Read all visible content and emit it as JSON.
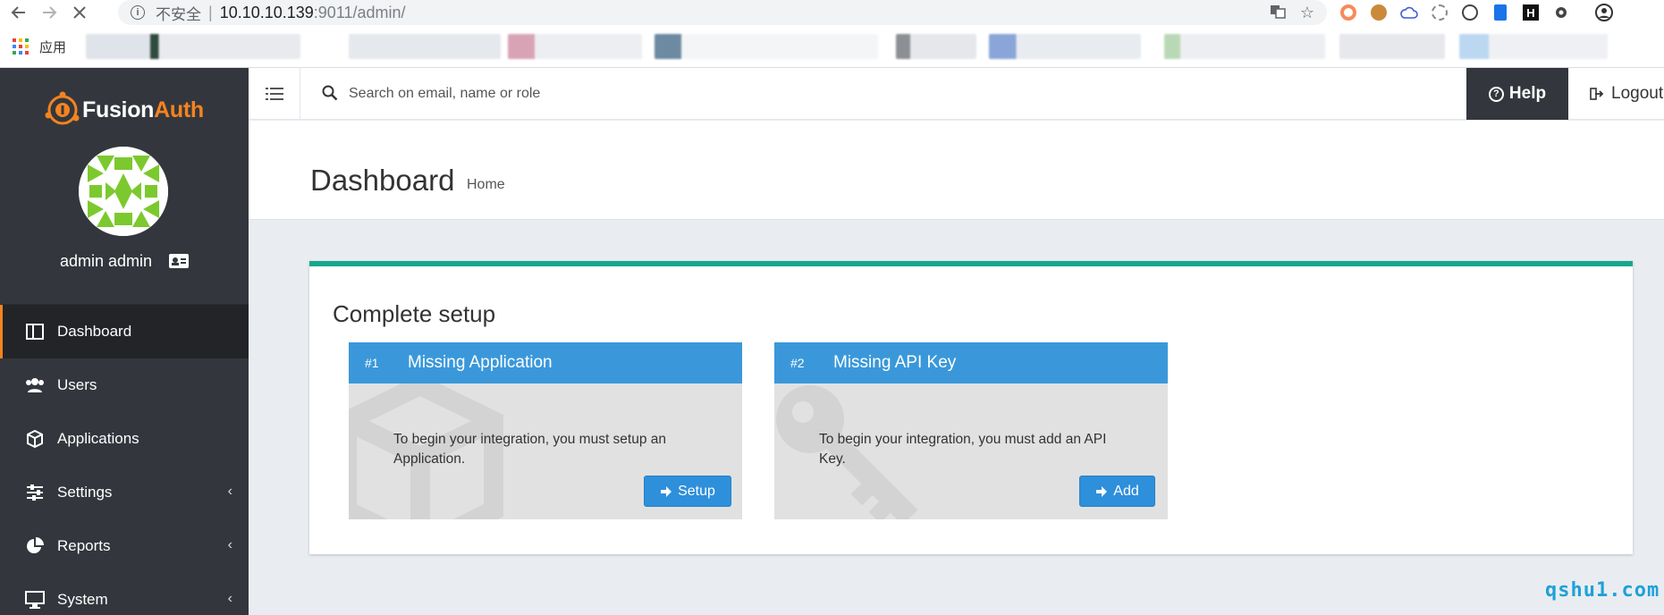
{
  "browser": {
    "address_insecure": "不安全",
    "address_separator": "|",
    "address_host": "10.10.10.139",
    "address_path": ":9011/admin/",
    "bookmarks_apps_label": "应用"
  },
  "sidebar": {
    "brand_prefix": "Fusion",
    "brand_suffix": "Auth",
    "username": "admin admin",
    "items": [
      {
        "label": "Dashboard",
        "icon": "dashboard-icon",
        "active": true,
        "expandable": false
      },
      {
        "label": "Users",
        "icon": "users-icon",
        "active": false,
        "expandable": false
      },
      {
        "label": "Applications",
        "icon": "cube-icon",
        "active": false,
        "expandable": false
      },
      {
        "label": "Settings",
        "icon": "sliders-icon",
        "active": false,
        "expandable": true
      },
      {
        "label": "Reports",
        "icon": "pie-chart-icon",
        "active": false,
        "expandable": true
      },
      {
        "label": "System",
        "icon": "desktop-icon",
        "active": false,
        "expandable": true
      }
    ],
    "chevron": "‹"
  },
  "topbar": {
    "search_placeholder": "Search on email, name or role",
    "help_label": "Help",
    "logout_label": "Logout"
  },
  "header": {
    "title": "Dashboard",
    "breadcrumb": "Home"
  },
  "setup": {
    "title": "Complete setup",
    "cards": [
      {
        "number": "#1",
        "title": "Missing Application",
        "text": "To begin your integration, you must setup an Application.",
        "button": "Setup"
      },
      {
        "number": "#2",
        "title": "Missing API Key",
        "text": "To begin your integration, you must add an API Key.",
        "button": "Add"
      }
    ]
  },
  "watermark": "qshu1.com",
  "colors": {
    "sidebar_bg": "#33373d",
    "brand_orange": "#f58320",
    "panel_accent": "#17a88b",
    "card_header": "#3a98da",
    "button_blue": "#2e8fdb",
    "avatar_green": "#7cc92f"
  }
}
